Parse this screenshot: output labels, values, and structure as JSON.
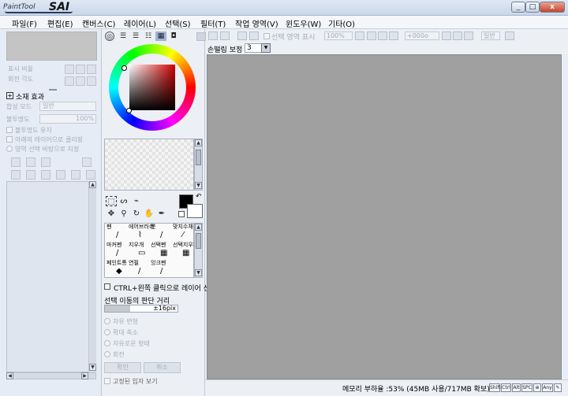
{
  "titlebar": {
    "logo_small": "PaintTool",
    "logo_big": "SAI",
    "btn_min": "_",
    "btn_max": "□",
    "btn_close": "x"
  },
  "menu": [
    "파일(F)",
    "편집(E)",
    "캔버스(C)",
    "레이어(L)",
    "선택(S)",
    "필터(T)",
    "작업 영역(V)",
    "윈도우(W)",
    "기타(O)"
  ],
  "layer_panel": {
    "opacity_label": "표시 비율",
    "angle_label": "회전 각도",
    "effect_label": "소재 효과",
    "blend_label": "합성 모드",
    "blend_value": "일반",
    "opacity2_label": "불투명도",
    "opacity2_value": "100%",
    "preserve_opacity": "불투명도 유지",
    "clip_below": "아래의 레이어으로 클리핑",
    "selection_source": "영역 선택 바탕으로 지정"
  },
  "tool_panel": {
    "tabs": [
      "color-wheel",
      "sliders",
      "rgb",
      "hsv",
      "swatches",
      "scratch"
    ],
    "main_color": "#000000",
    "sub_color": "#ffffff",
    "selected_hue": "#d10000",
    "tools_row1": [
      "⬚",
      "ᔕ",
      "⌁"
    ],
    "tools_row2": [
      "✥",
      "⚲",
      "↻",
      "✋",
      "✒"
    ],
    "brushes": [
      {
        "label": "펜",
        "icon": "/"
      },
      {
        "label": "에어브러쉬",
        "icon": "⌇"
      },
      {
        "label": "붓",
        "icon": "/"
      },
      {
        "label": "맞지수채",
        "icon": "⁄"
      },
      {
        "label": "마커펜",
        "icon": "/"
      },
      {
        "label": "지우개",
        "icon": "▭"
      },
      {
        "label": "선택펜",
        "icon": "▦"
      },
      {
        "label": "선택지우개",
        "icon": "▦"
      },
      {
        "label": "페인트통",
        "icon": "◆"
      },
      {
        "label": "연필",
        "icon": "/"
      },
      {
        "label": "잉크펜",
        "icon": "/"
      }
    ],
    "ctrl_label": "CTRL+왼쪽 클릭으로 레이어 선택",
    "dist_label": "선택 이동의 판단 거리",
    "dist_value": "±16pix",
    "dist_fraction": 0.35,
    "transform": [
      "자유 변형",
      "확대 축소",
      "자유로운 형태",
      "회전"
    ],
    "ok_label": "확인",
    "cancel_label": "취소",
    "bottom_label": "고정된 입자 보기"
  },
  "toolbar": {
    "show_selection": "선택 영역 표시",
    "zoom": "100%",
    "angle": "+000o",
    "mode": "일반"
  },
  "stabilizer": {
    "label": "손떨림 보정",
    "value": "3"
  },
  "statusbar": {
    "memory": "메모리 부하율 :53% (45MB 사용/717MB 확보)",
    "keys": [
      "Shift",
      "Ctrl",
      "Alt",
      "SPC",
      "⊕",
      "Any",
      "✎"
    ]
  }
}
